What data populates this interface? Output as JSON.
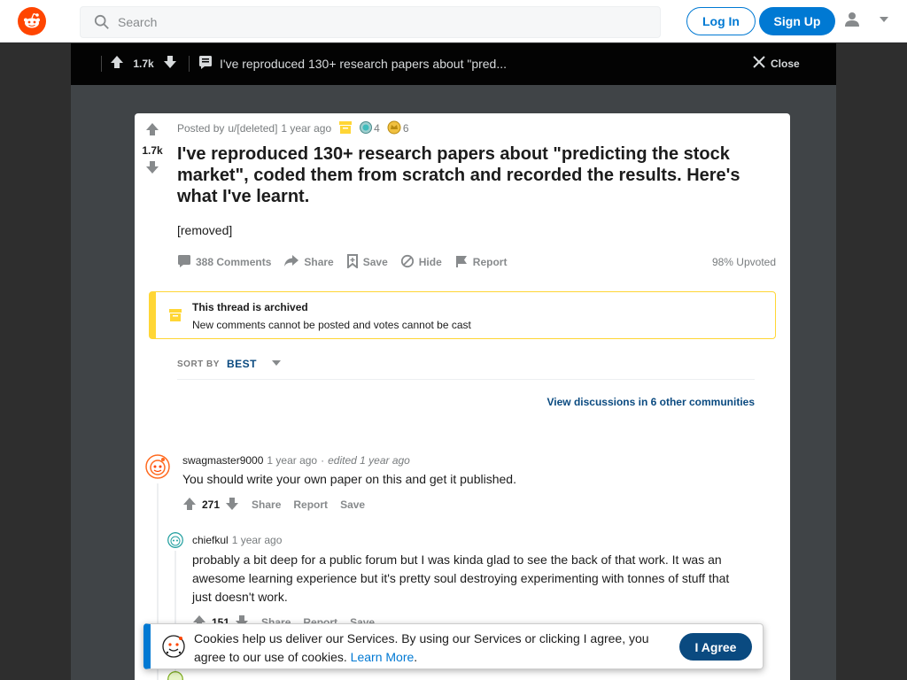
{
  "header": {
    "search_placeholder": "Search",
    "login_label": "Log In",
    "signup_label": "Sign Up"
  },
  "postbar": {
    "vote_count": "1.7k",
    "title": "I've reproduced 130+ research papers about \"pred...",
    "close_label": "Close"
  },
  "post": {
    "vote_count": "1.7k",
    "posted_by_label": "Posted by",
    "author": "u/[deleted]",
    "time": "1 year ago",
    "award_count_1": "4",
    "award_count_2": "6",
    "title": "I've reproduced 130+ research papers about \"predicting the stock market\", coded them from scratch and recorded the results. Here's what I've learnt.",
    "body": "[removed]",
    "comments_label": "388 Comments",
    "share_label": "Share",
    "save_label": "Save",
    "hide_label": "Hide",
    "report_label": "Report",
    "upvoted_label": "98% Upvoted"
  },
  "archived": {
    "title": "This thread is archived",
    "text": "New comments cannot be posted and votes cannot be cast"
  },
  "sort": {
    "label": "SORT BY",
    "value": "BEST"
  },
  "view_discussions": "View discussions in 6 other communities",
  "comments": [
    {
      "author": "swagmaster9000",
      "time": "1 year ago",
      "dot": "·",
      "edited": "edited 1 year ago",
      "text": "You should write your own paper on this and get it published.",
      "votes": "271",
      "share": "Share",
      "report": "Report",
      "save": "Save"
    },
    {
      "author": "chiefkul",
      "time": "1 year ago",
      "text": "probably a bit deep for a public forum but I was kinda glad to see the back of that work. It was an awesome learning experience but it's pretty soul destroying experimenting with tonnes of stuff that just doesn't work.",
      "votes": "151",
      "share": "Share",
      "report": "Report",
      "save": "Save"
    }
  ],
  "cookie": {
    "text": "Cookies help us deliver our Services. By using our Services or clicking I agree, you agree to our use of cookies.",
    "link": "Learn More",
    "period": ".",
    "agree_label": "I Agree"
  },
  "colors": {
    "brand": "#ff4500",
    "accent": "#0079d3",
    "archived": "#ffd635"
  }
}
